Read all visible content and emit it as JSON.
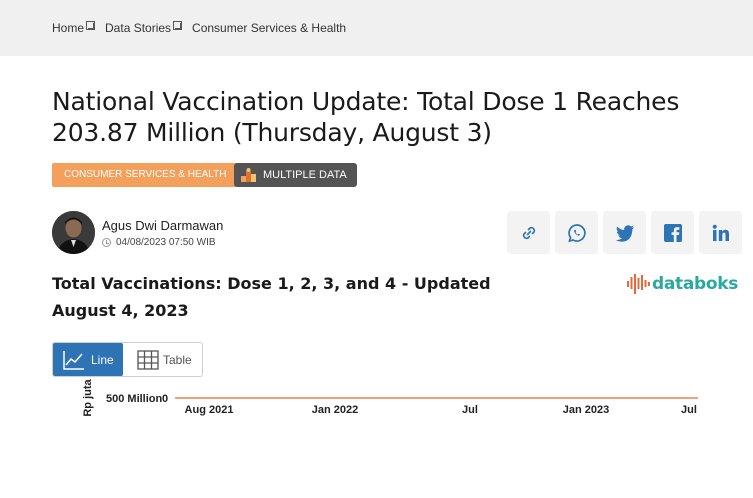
{
  "breadcrumb": {
    "items": [
      "Home",
      "Data Stories",
      "Consumer Services & Health"
    ]
  },
  "article": {
    "title": "National Vaccination Update: Total Dose 1 Reaches 203.87 Million (Thursday, August 3)",
    "category_badge": "CONSUMER SERVICES & HEALTH",
    "multi_badge": "MULTIPLE DATA",
    "author": "Agus Dwi Darmawan",
    "date": "04/08/2023 07:50 WIB"
  },
  "share": {
    "icons": [
      "link-icon",
      "whatsapp-icon",
      "twitter-icon",
      "facebook-icon",
      "linkedin-icon"
    ]
  },
  "chart_section": {
    "heading": "Total Vaccinations: Dose 1, 2, 3, and 4 - Updated August 4, 2023",
    "brand": "databoks",
    "view_toggle": {
      "line_label": "Line",
      "table_label": "Table"
    }
  },
  "colors": {
    "category_badge": "#f2a05c",
    "multi_badge": "#545454",
    "toggle_active": "#2e74b5",
    "brand": "#2aa9a0",
    "series_line": "#f0a27a"
  },
  "chart_data": {
    "type": "line",
    "ylabel": "Rp juta",
    "y_tick_labels": [
      "500 Million",
      "0"
    ],
    "x_tick_labels": [
      "Aug 2021",
      "Jan 2022",
      "Jul",
      "Jan 2023",
      "Jul"
    ],
    "grid": false
  }
}
